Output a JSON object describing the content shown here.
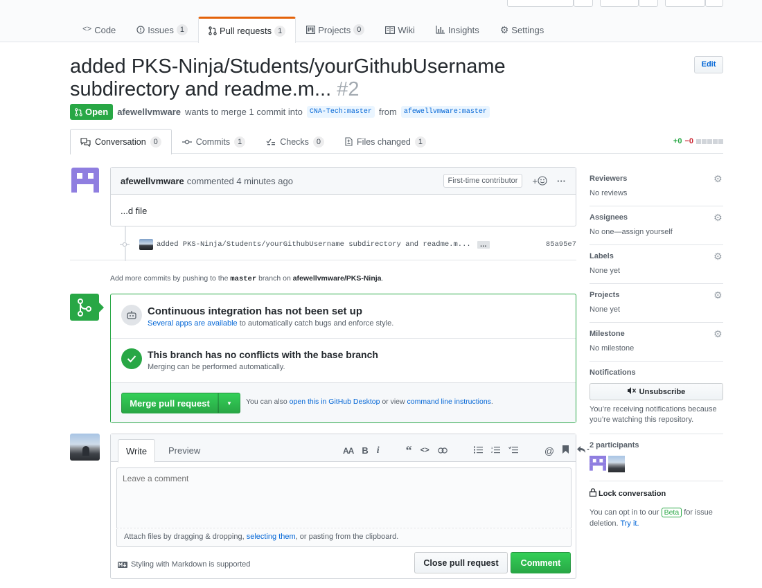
{
  "repo_nav": {
    "items": [
      {
        "label": "Code",
        "icon": "code-icon"
      },
      {
        "label": "Issues",
        "count": "1",
        "icon": "issue-icon"
      },
      {
        "label": "Pull requests",
        "count": "1",
        "icon": "pull-request-icon"
      },
      {
        "label": "Projects",
        "count": "0",
        "icon": "project-icon"
      },
      {
        "label": "Wiki",
        "icon": "book-icon"
      },
      {
        "label": "Insights",
        "icon": "graph-icon"
      },
      {
        "label": "Settings",
        "icon": "gear-icon"
      }
    ]
  },
  "pr": {
    "title": "added PKS-Ninja/Students/yourGithubUsername subdirectory and readme.m...",
    "number": "#2",
    "edit_label": "Edit",
    "state": "Open",
    "author": "afewellvmware",
    "merge_text": "wants to merge 1 commit into",
    "base": "CNA-Tech:master",
    "from_text": "from",
    "head": "afewellvmware:master"
  },
  "tabs": [
    {
      "label": "Conversation",
      "count": "0",
      "icon": "comment-discussion-icon"
    },
    {
      "label": "Commits",
      "count": "1",
      "icon": "commit-icon"
    },
    {
      "label": "Checks",
      "count": "0",
      "icon": "checklist-icon"
    },
    {
      "label": "Files changed",
      "count": "1",
      "icon": "file-diff-icon"
    }
  ],
  "diffstat": {
    "added": "+0",
    "removed": "−0"
  },
  "comment": {
    "author": "afewellvmware",
    "action": "commented 4 minutes ago",
    "badge": "First-time contributor",
    "reaction": "+",
    "more": "···",
    "body": "...d file"
  },
  "commit": {
    "message": "added PKS-Ninja/Students/yourGithubUsername subdirectory and readme.m...",
    "ellipsis": "…",
    "sha": "85a95e7"
  },
  "push_note": {
    "prefix": "Add more commits by pushing to the",
    "branch": "master",
    "middle": "branch on",
    "repo": "afewellvmware/PKS-Ninja",
    "suffix": "."
  },
  "merge": {
    "ci_title": "Continuous integration has not been set up",
    "ci_link": "Several apps are available",
    "ci_rest": "to automatically catch bugs and enforce style.",
    "conflict_title": "This branch has no conflicts with the base branch",
    "conflict_sub": "Merging can be performed automatically.",
    "merge_btn": "Merge pull request",
    "also_text": "You can also",
    "desktop_link": "open this in GitHub Desktop",
    "or_text": "or view",
    "cli_link": "command line instructions",
    "end": "."
  },
  "editor": {
    "write_tab": "Write",
    "preview_tab": "Preview",
    "placeholder": "Leave a comment",
    "attach_prefix": "Attach files by dragging & dropping,",
    "attach_link": "selecting them",
    "attach_suffix": ", or pasting from the clipboard.",
    "markdown_note": "Styling with Markdown is supported",
    "close_btn": "Close pull request",
    "comment_btn": "Comment",
    "toolbar": {
      "header": "AA",
      "bold": "B",
      "italic": "i",
      "quote": "“",
      "code": "<>"
    }
  },
  "sidebar": {
    "reviewers": {
      "label": "Reviewers",
      "value": "No reviews"
    },
    "assignees": {
      "label": "Assignees",
      "value": "No one—assign yourself"
    },
    "labels": {
      "label": "Labels",
      "value": "None yet"
    },
    "projects": {
      "label": "Projects",
      "value": "None yet"
    },
    "milestone": {
      "label": "Milestone",
      "value": "No milestone"
    },
    "notifications": {
      "label": "Notifications",
      "button": "Unsubscribe",
      "note": "You’re receiving notifications because you’re watching this repository."
    },
    "participants": {
      "label": "2 participants"
    },
    "lock": {
      "label": "Lock conversation"
    },
    "beta": {
      "prefix": "You can opt in to our",
      "badge": "Beta",
      "middle": "for issue deletion.",
      "link": "Try it."
    }
  },
  "colors": {
    "accent": "#28a745",
    "link": "#0366d6",
    "nav_active": "#e36209"
  }
}
